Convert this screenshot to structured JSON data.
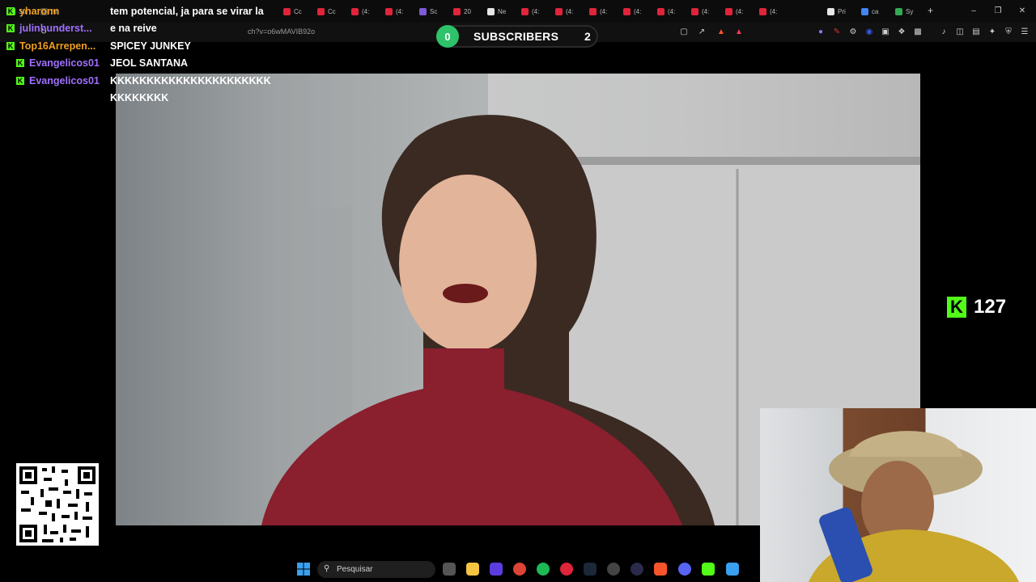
{
  "browser": {
    "tabs": [
      {
        "label": "Str",
        "color": "#53fc18"
      },
      {
        "label": "“u",
        "color": "#444444"
      },
      {
        "label": "Cc",
        "color": "#e0243a"
      },
      {
        "label": "Cc",
        "color": "#e0243a"
      },
      {
        "label": "(4:",
        "color": "#e0243a"
      },
      {
        "label": "(4:",
        "color": "#e0243a"
      },
      {
        "label": "Sc",
        "color": "#7d5ad8"
      },
      {
        "label": "20",
        "color": "#e0243a"
      },
      {
        "label": "Ne",
        "color": "#e6e6e6"
      },
      {
        "label": "(4:",
        "color": "#e0243a"
      },
      {
        "label": "(4:",
        "color": "#e0243a"
      },
      {
        "label": "(4:",
        "color": "#e0243a"
      },
      {
        "label": "(4:",
        "color": "#e0243a"
      },
      {
        "label": "(4:",
        "color": "#e0243a"
      },
      {
        "label": "(4:",
        "color": "#e0243a"
      },
      {
        "label": "(4:",
        "color": "#e0243a"
      },
      {
        "label": "(4:",
        "color": "#e0243a"
      },
      {
        "label": "Pri",
        "color": "#e6e6e6"
      },
      {
        "label": "ca",
        "color": "#4285f4"
      },
      {
        "label": "Sy",
        "color": "#34a853"
      }
    ],
    "new_tab": "+",
    "url": "ch?v=o6wMAVIB92o"
  },
  "chat": [
    {
      "user": "yharonn",
      "user_color": "#f0a020",
      "message": "tem potencial, ja para se virar la",
      "badge": "K"
    },
    {
      "user": "julinhunderst...",
      "user_color": "#a070ff",
      "message": "e na reive",
      "badge": "K"
    },
    {
      "user": "Top16Arrepen...",
      "user_color": "#f0a020",
      "message": "SPICEY JUNKEY",
      "badge": "K"
    },
    {
      "user": "Evangelicos01",
      "user_color": "#a070ff",
      "message": "JEOL SANTANA",
      "badge": "K"
    },
    {
      "user": "Evangelicos01",
      "user_color": "#a070ff",
      "message": "KKKKKKKKKKKKKKKKKKKKKK",
      "badge": "K"
    }
  ],
  "chat_continuation": "KKKKKKKK",
  "subscribers": {
    "count_left": "0",
    "label": "SUBSCRIBERS",
    "count_right": "2"
  },
  "viewer_counter": {
    "logo": "K",
    "count": "127"
  },
  "taskbar": {
    "search_placeholder": "Pesquisar"
  },
  "colors": {
    "kick_green": "#53fc18",
    "subs_green": "#2ec26a"
  }
}
